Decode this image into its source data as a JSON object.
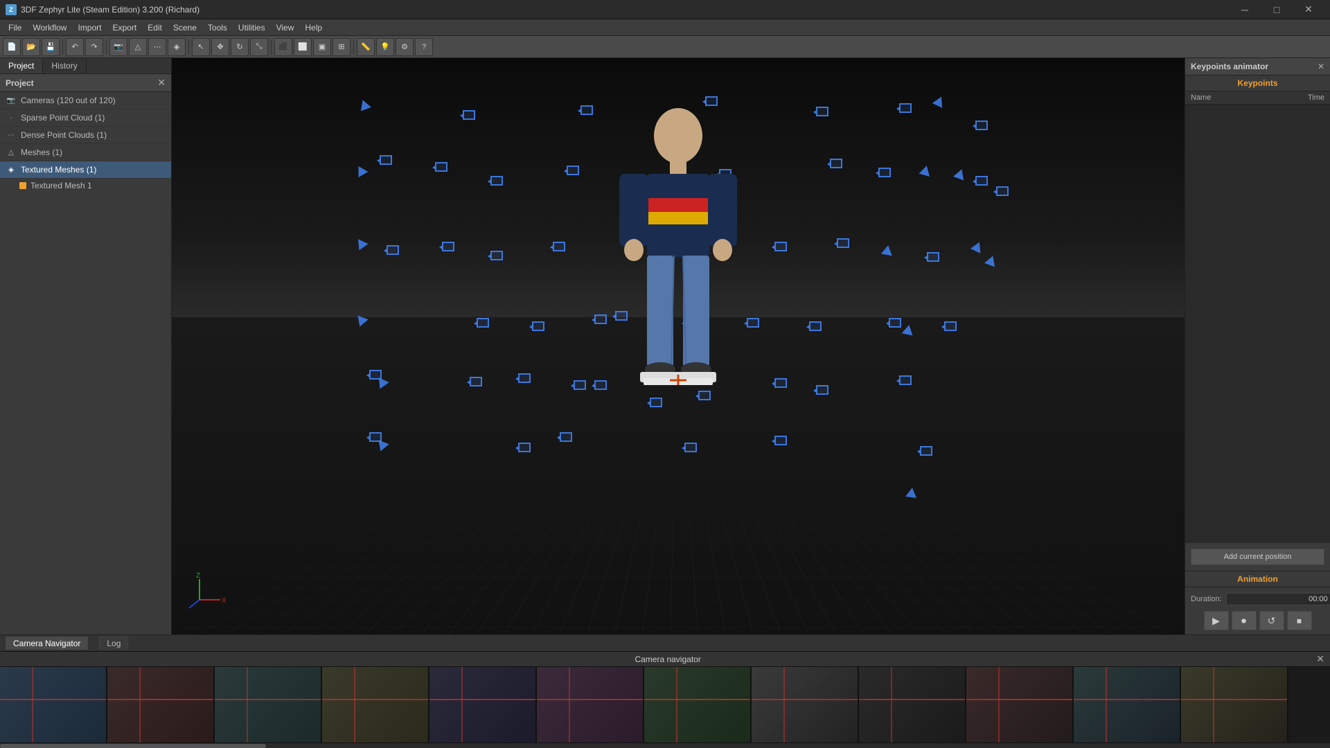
{
  "app": {
    "title": "3DF Zephyr Lite (Steam Edition) 3.200 (Richard)"
  },
  "titlebar": {
    "minimize": "─",
    "maximize": "□",
    "close": "✕"
  },
  "menubar": {
    "items": [
      "File",
      "Workflow",
      "Import",
      "Export",
      "Edit",
      "Scene",
      "Tools",
      "Utilities",
      "View",
      "Help"
    ]
  },
  "left_panel": {
    "tabs": [
      "Project",
      "History"
    ],
    "header": "Project",
    "close_btn": "✕",
    "tree": [
      {
        "label": "Cameras (120 out of 120)",
        "icon": "📷",
        "type": "cameras"
      },
      {
        "label": "Sparse Point Cloud (1)",
        "icon": "·",
        "type": "sparse"
      },
      {
        "label": "Dense Point Clouds (1)",
        "icon": "⋯",
        "type": "dense"
      },
      {
        "label": "Meshes (1)",
        "icon": "△",
        "type": "meshes"
      },
      {
        "label": "Textured Meshes (1)",
        "icon": "◈",
        "type": "textured",
        "active": true
      }
    ],
    "child_item": "Textured Mesh 1"
  },
  "right_panel": {
    "title": "Keypoints animator",
    "close_btn": "✕",
    "keypoints_label": "Keypoints",
    "col_name": "Name",
    "col_time": "Time",
    "add_position_btn": "Add current position",
    "animation_label": "Animation",
    "duration_label": "Duration:",
    "duration_value": "00:00"
  },
  "statusbar": {
    "tabs": [
      "Camera Navigator",
      "Log"
    ]
  },
  "camera_navigator": {
    "title": "Camera navigator",
    "close_btn": "✕",
    "thumb_count": 12
  },
  "playback": {
    "play": "▶",
    "record": "⏺",
    "loop": "↺",
    "end": "⏹"
  }
}
